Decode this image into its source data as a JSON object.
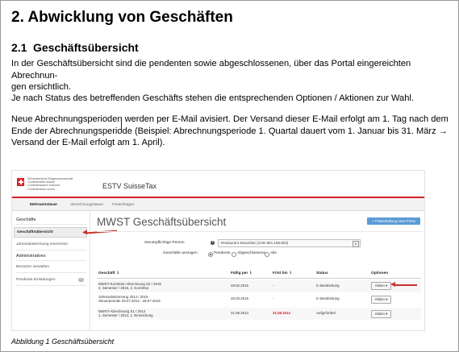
{
  "document": {
    "heading1": "2. Abwicklung von Geschäften",
    "section_number": "2.1",
    "section_title": "Geschäftsübersicht",
    "paragraph1_line1": "In der Geschäftsübersicht sind die pendenten sowie abgeschlossenen, über das Portal eingereichten Abrechnun-",
    "paragraph1_line2": "gen ersichtlich.",
    "paragraph2": "Je nach Status des betreffenden Geschäfts stehen die entsprechenden Optionen / Aktionen zur Wahl.",
    "paragraph3_line1": "Neue Abrechnungsperioden werden per E-Mail avisiert. Der Versand dieser E-Mail erfolgt am 1. Tag nach dem",
    "paragraph3_line2": "Ende der Abrechnungsperiode (Beispiel: Abrechnungsperiode 1. Quartal dauert vom 1. Januar bis 31. März →",
    "paragraph3_line3": "Versand der E-Mail erfolgt am 1. April).",
    "caption": "Abbildung 1 Geschäftsübersicht"
  },
  "screenshot": {
    "confederation_lines": [
      "Schweizerische Eidgenossenschaft",
      "Confédération suisse",
      "Confederazione Svizzera",
      "Confederaziun svizra"
    ],
    "app_title": "ESTV SuisseTax",
    "nav_tabs": [
      "Mehrwertsteuer",
      "Verrechnungssteuer",
      "Fristenfragen"
    ],
    "sidebar": {
      "section1": "Geschäfte",
      "item_active": "Geschäftsübersicht",
      "item2": "Jahresabstimmung einreichen",
      "section2": "Administratives",
      "item3": "Benutzer verwalten",
      "item4": "Pendente Einladungen",
      "item4_badge": "0"
    },
    "page_title": "MWST Geschäftsübersicht",
    "new_button": "+ Fristenhaltung neue Frima",
    "filter": {
      "taxpayer_label": "Steuerpflichtige Person",
      "help_glyph": "?",
      "taxpayer_value": "Restaurant Steuerbar (CHE-851.188.803)",
      "show_label": "Geschäfte anzeigen",
      "radio_options": [
        "Pendente",
        "Abgeschlossene",
        "Alle"
      ]
    },
    "table": {
      "headers": [
        "Geschäft ⇂",
        "Fällig per ⇂",
        "Frist bis ⇂",
        "Status",
        "Optionen"
      ],
      "rows": [
        {
          "title": "MWST-Korrektur-Abrechnung S2 / 2015",
          "subtitle": "2. Semester / 2015, 2. Korrektur",
          "due": "28.02.2016",
          "deadline": "-",
          "status": "In Bearbeitung",
          "action": "Aktion ▾"
        },
        {
          "title": "Jahresabstimmung 2014 / 2015",
          "subtitle": "Steuerperiode 29.07.2014 - 28.07.2015",
          "due": "28.03.2016",
          "deadline": "-",
          "status": "In Bearbeitung",
          "action": "Aktion ▾"
        },
        {
          "title": "MWST-Abrechnung S1 / 2014",
          "subtitle": "1. Semester / 2014, 1. Einreichung",
          "due": "31.08.2014",
          "deadline": "31.08.2014",
          "status": "Aufgefordert",
          "action": "Aktion ▾"
        }
      ]
    }
  },
  "colors": {
    "accent_red": "#d8232a",
    "arrow_red": "#c8302c",
    "button_blue": "#5b9bd5"
  }
}
